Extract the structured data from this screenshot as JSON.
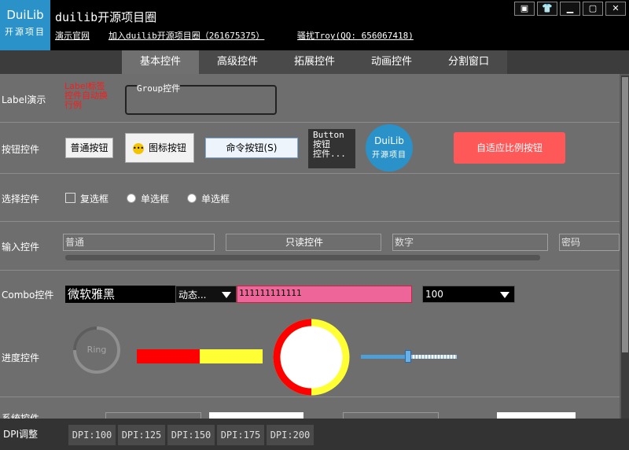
{
  "window": {
    "logo_line1": "DuiLib",
    "logo_line2": "开源项目",
    "title": "duilib开源项目圈",
    "links": [
      "演示官网",
      "加入duilib开源项目圈（261675375）",
      "骚扰Troy(QQ: 656067418)"
    ],
    "buttons": [
      "▣",
      "👕",
      "▁",
      "▢",
      "✕"
    ]
  },
  "tabs": [
    "基本控件",
    "高级控件",
    "拓展控件",
    "动画控件",
    "分割窗口"
  ],
  "rows": {
    "label": {
      "title": "Label演示",
      "red_text": "Label标签控件自动换行例",
      "group_title": "Group控件"
    },
    "button": {
      "title": "按钮控件",
      "normal": "普通按钮",
      "icon": "图标按钮",
      "command": "命令按钮(S)",
      "multiline": [
        "Button",
        "按钮",
        "控件..."
      ],
      "circle_line1": "DuiLib",
      "circle_line2": "开源项目",
      "adaptive": "自适应比例按钮"
    },
    "select": {
      "title": "选择控件",
      "checkbox": "复选框",
      "radio1": "单选框",
      "radio2": "单选框"
    },
    "input": {
      "title": "输入控件",
      "normal": "普通",
      "readonly": "只读控件",
      "number": "数字",
      "password": "密码"
    },
    "combo": {
      "title": "Combo控件",
      "font": "微软雅黑",
      "dynamic": "动态...",
      "pink_value": "111111111111",
      "num_value": "100"
    },
    "progress": {
      "title": "进度控件",
      "ring": "Ring",
      "bar_fraction": 0.5,
      "circle_fraction": 0.5
    },
    "partial_next_row": "系统控件"
  },
  "bottom": {
    "label": "DPI调整",
    "dpi_buttons": [
      "DPI:100",
      "DPI:125",
      "DPI:150",
      "DPI:175",
      "DPI:200"
    ]
  },
  "colors": {
    "accent_blue": "#2a92c8",
    "adaptive_red": "#ff5858",
    "progress_red": "#ff0000",
    "progress_yellow": "#ffff33",
    "pink_input": "#ee6699"
  }
}
